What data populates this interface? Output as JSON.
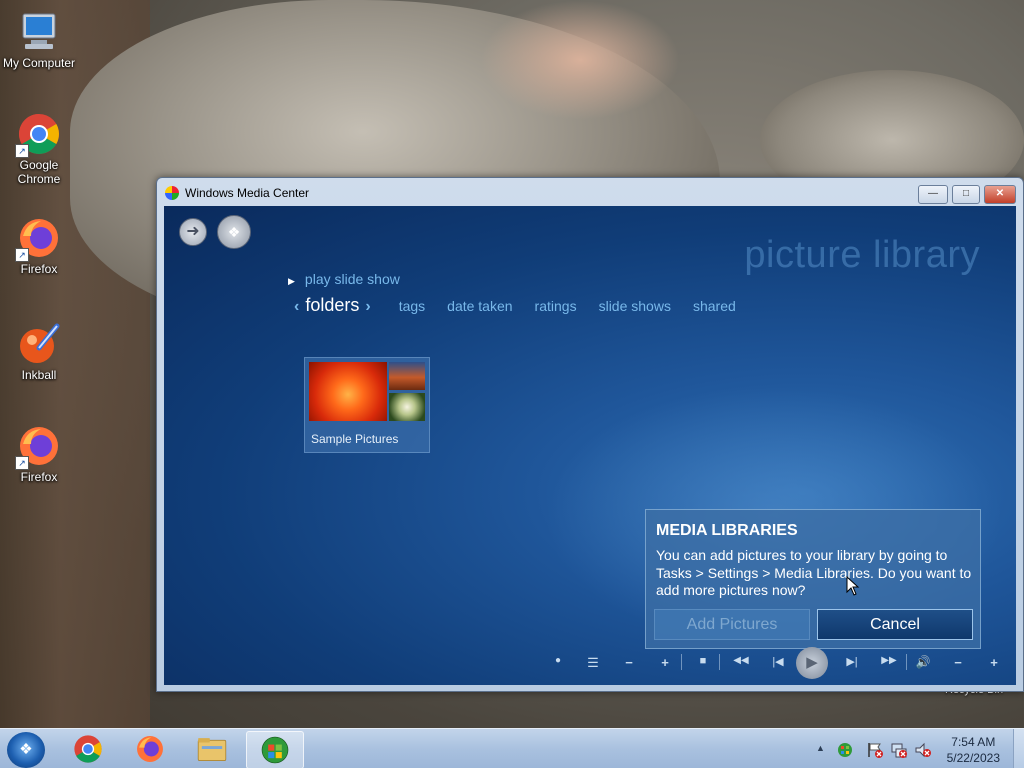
{
  "desktop": {
    "icons": [
      {
        "label": "My Computer",
        "icon": "computer-icon"
      },
      {
        "label": "Google Chrome",
        "icon": "chrome-icon"
      },
      {
        "label": "Firefox",
        "icon": "firefox-icon"
      },
      {
        "label": "Inkball",
        "icon": "inkball-icon"
      },
      {
        "label": "Firefox",
        "icon": "firefox-icon"
      }
    ],
    "recycle_partial": "Recycle Bin"
  },
  "window": {
    "title": "Windows Media Center",
    "buttons": {
      "minimize": "—",
      "maximize": "□",
      "close": "✕"
    }
  },
  "media_center": {
    "heading": "picture library",
    "play_slide_show": "play slide show",
    "nav": {
      "current": "folders",
      "tabs": [
        "tags",
        "date taken",
        "ratings",
        "slide shows",
        "shared"
      ]
    },
    "tiles": [
      {
        "label": "Sample Pictures"
      }
    ],
    "dialog": {
      "title": "MEDIA LIBRARIES",
      "body": "You can add pictures to your library by going to Tasks > Settings > Media Libraries. Do you want to add more pictures now?",
      "add_label": "Add Pictures",
      "cancel_label": "Cancel"
    },
    "transport": {
      "record": "●",
      "guide": "☰",
      "ch_down": "−",
      "ch_up": "+",
      "stop": "■",
      "rewind": "◀◀",
      "prev": "|◀",
      "play": "▶",
      "next": "▶|",
      "forward": "▶▶",
      "mute": "🔊",
      "vol_down": "−",
      "vol_up": "+"
    }
  },
  "taskbar": {
    "clock_time": "7:54 AM",
    "clock_date": "5/22/2023",
    "tray_expand": "▲"
  },
  "colors": {
    "mc_accent": "#78b8ea",
    "mc_background": "#103d78",
    "taskbar": "#a9c1df"
  }
}
